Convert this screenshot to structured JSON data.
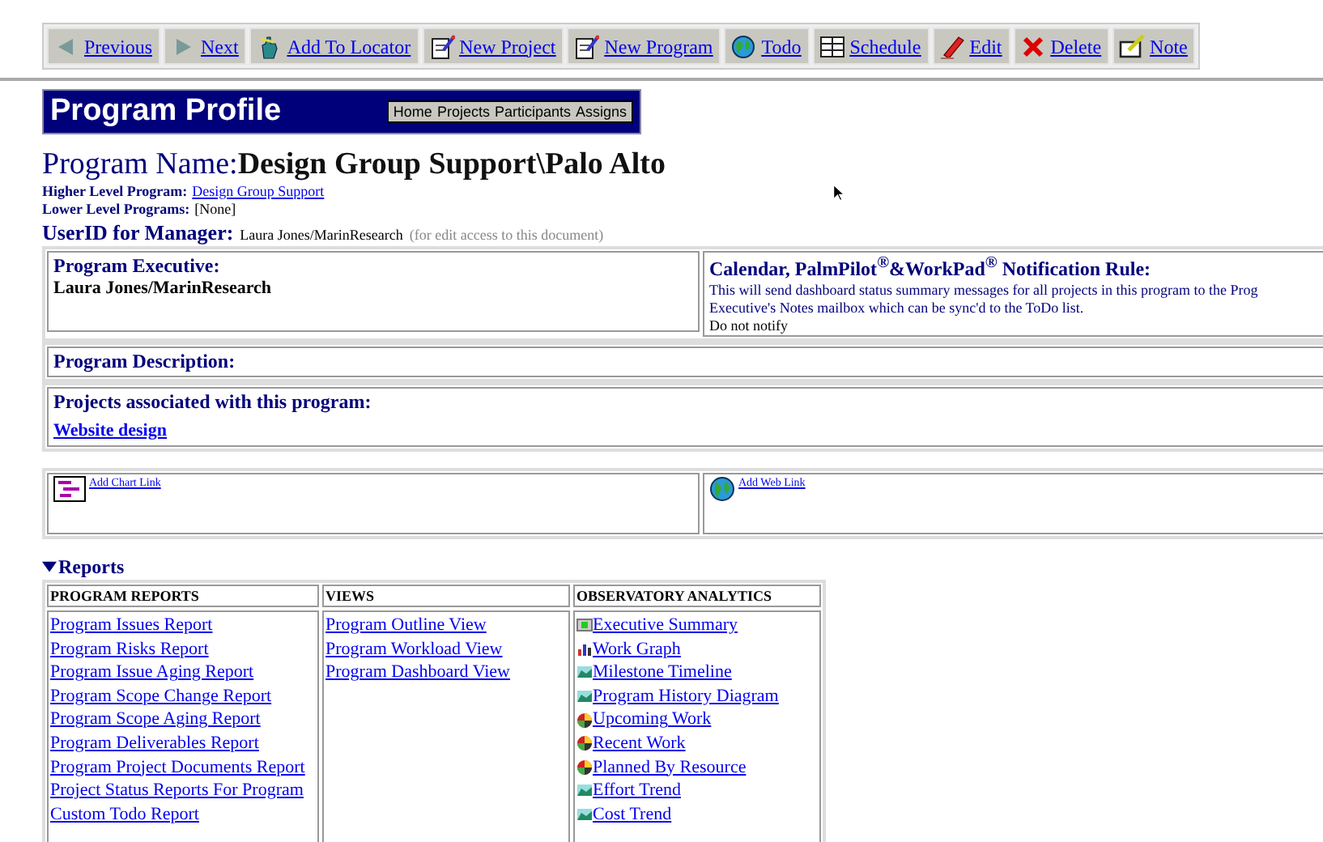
{
  "toolbar": [
    {
      "kind": "prev",
      "label": "Previous"
    },
    {
      "kind": "next",
      "label": "Next"
    },
    {
      "kind": "hand",
      "label": "Add To Locator"
    },
    {
      "kind": "pad",
      "label": "New Project"
    },
    {
      "kind": "pad",
      "label": "New Program"
    },
    {
      "kind": "globe",
      "label": "Todo"
    },
    {
      "kind": "grid",
      "label": "Schedule"
    },
    {
      "kind": "pencil",
      "label": "Edit"
    },
    {
      "kind": "cross",
      "label": "Delete"
    },
    {
      "kind": "note",
      "label": "Note"
    }
  ],
  "header": {
    "title": "Program Profile",
    "nav": [
      "Home",
      "Projects",
      "Participants",
      "Assigns"
    ]
  },
  "program": {
    "name_label": "Program Name:",
    "name": "Design Group Support\\Palo Alto",
    "higher_label": "Higher Level Program:",
    "higher": "Design Group Support",
    "lower_label": "Lower Level Programs:",
    "lower": "[None]",
    "manager_label": "UserID for Manager:",
    "manager": "Laura Jones/MarinResearch",
    "manager_note": "(for edit access to this document)"
  },
  "executive": {
    "label": "Program Executive:",
    "value": "Laura Jones/MarinResearch"
  },
  "notification": {
    "title": "Calendar, PalmPilot$^{®}$&WorkPad$^{®}$ Notification Rule:",
    "line_1": "This will send dashboard status summary messages for all projects in this program to the Prog",
    "line_2": "Executive's Notes mailbox which can be sync'd to the ToDo list.",
    "value": "Do not notify"
  },
  "description": {
    "label": "Program Description:"
  },
  "projects": {
    "label": "Projects associated with this program:",
    "items": [
      "Website design"
    ]
  },
  "links": [
    {
      "kind": "chart",
      "label": "Add Chart Link"
    },
    {
      "kind": "web",
      "label": "Add Web Link"
    }
  ],
  "reports": {
    "title": "Reports",
    "expanded": true,
    "columns": [
      {
        "heading": "PROGRAM REPORTS",
        "items": [
          {
            "label": "Program Issues Report"
          },
          {
            "label": "Program Risks Report"
          },
          {
            "label": "Program Issue Aging Report"
          },
          {
            "label": "Program Scope Change Report"
          },
          {
            "label": "Program Scope Aging Report"
          },
          {
            "label": "Program Deliverables Report"
          },
          {
            "label": "Program Project Documents Report"
          },
          {
            "label": "Project Status Reports For Program"
          },
          {
            "label": "Custom Todo Report"
          }
        ]
      },
      {
        "heading": "VIEWS",
        "items": [
          {
            "label": "Program Outline View"
          },
          {
            "label": "Program Workload View"
          },
          {
            "label": "Program Dashboard View"
          }
        ]
      },
      {
        "heading": "OBSERVATORY ANALYTICS",
        "items": [
          {
            "kind": "summary",
            "label": "Executive Summary"
          },
          {
            "kind": "bars",
            "label": "Work Graph"
          },
          {
            "kind": "chart",
            "label": "Milestone Timeline"
          },
          {
            "kind": "chart",
            "label": "Program History Diagram"
          },
          {
            "kind": "pie",
            "label": "Upcoming Work"
          },
          {
            "kind": "pie",
            "label": "Recent Work"
          },
          {
            "kind": "pie",
            "label": "Planned By Resource"
          },
          {
            "kind": "chart",
            "label": "Effort Trend"
          },
          {
            "kind": "chart",
            "label": "Cost Trend"
          }
        ]
      }
    ]
  }
}
